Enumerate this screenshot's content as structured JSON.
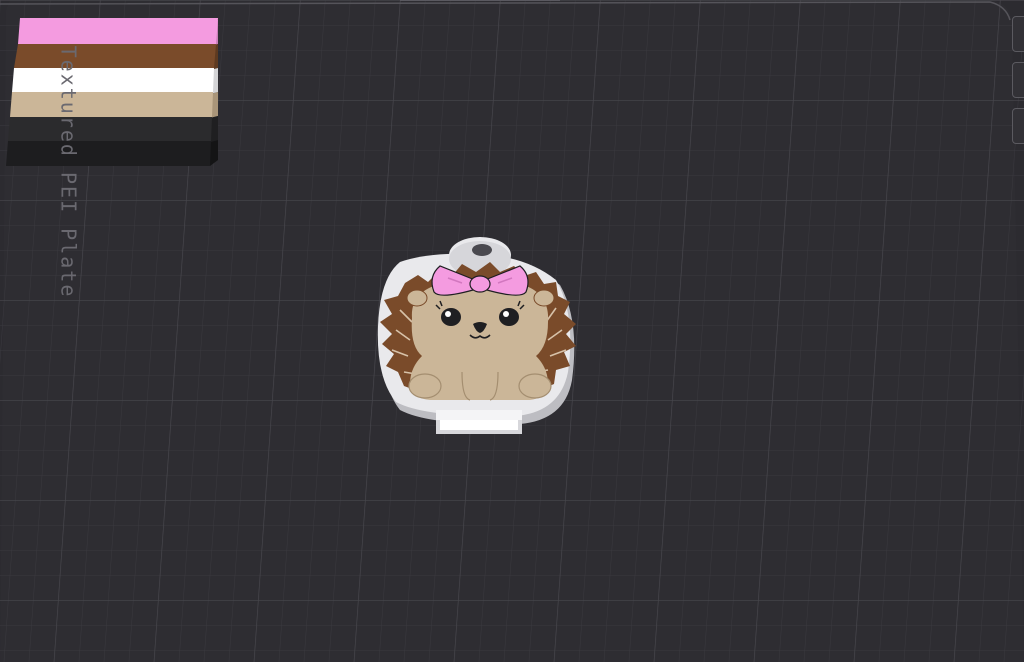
{
  "viewport": {
    "name": "3D build plate",
    "bed_label": "Textured PEI Plate"
  },
  "objects": {
    "color_swatch": {
      "name": "filament-color-swatch",
      "colors": [
        "#f49be0",
        "#7a4b2a",
        "#ffffff",
        "#cbb698",
        "#2b2b2d",
        "#1d1d1f"
      ]
    },
    "keychain": {
      "name": "hedgehog-keychain",
      "colors": {
        "base": "#e9e9ec",
        "spikes": "#7a4b2a",
        "body": "#cbb698",
        "bow": "#f49be0",
        "features": "#1f1f22"
      }
    }
  },
  "side_tools": [
    "tool-1",
    "tool-2",
    "tool-3"
  ]
}
